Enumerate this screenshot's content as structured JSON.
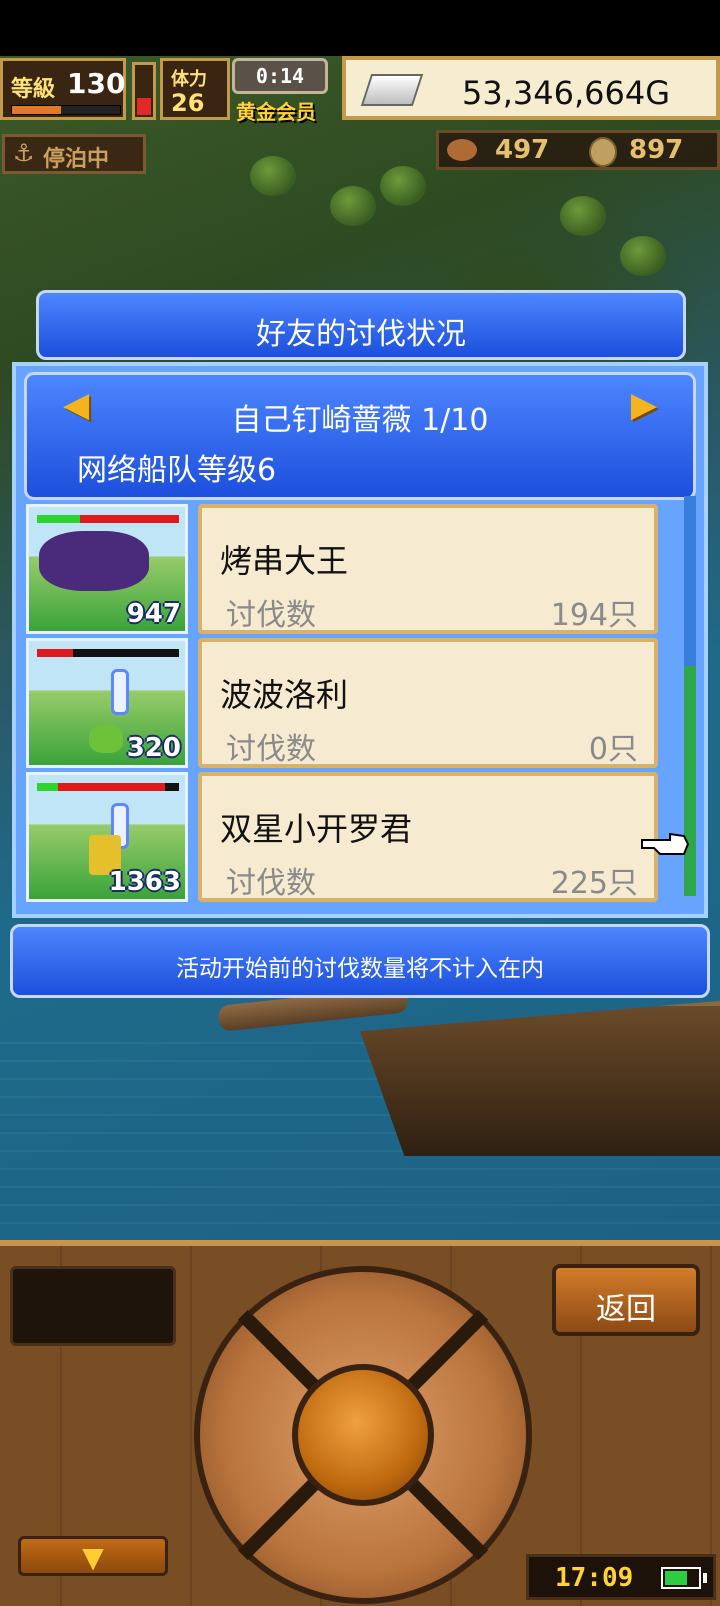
{
  "hud": {
    "level_label": "等級",
    "level": "130",
    "exp_fraction": 0.45,
    "stamina_fraction": 0.35,
    "stamina_label": "体力",
    "stamina": "26",
    "timer": "0:14",
    "member_label": "黄金会员",
    "gold": "53,346,664G",
    "anchored_label": "停泊中",
    "meat": "497",
    "coins": "897"
  },
  "dialog": {
    "title": "好友的讨伐状况",
    "friend_name": "自己钉崎蔷薇 1/10",
    "fleet_level": "网络船队等级6",
    "prev_icon": "◀",
    "next_icon": "▶",
    "rows": [
      {
        "name": "烤串大王",
        "label": "讨伐数",
        "value": "194只",
        "badge": "947",
        "hp_green": 0.3,
        "hp_red": 0.7
      },
      {
        "name": "波波洛利",
        "label": "讨伐数",
        "value": "0只",
        "badge": "320",
        "hp_green": 0.0,
        "hp_red": 0.25
      },
      {
        "name": "双星小开罗君",
        "label": "讨伐数",
        "value": "225只",
        "badge": "1363",
        "hp_green": 0.15,
        "hp_red": 0.75
      }
    ],
    "notice": "活动开始前的讨伐数量将不计入在内"
  },
  "controls": {
    "back_label": "返回",
    "menu_arrow": "▼",
    "clock": "17:09",
    "battery_fraction": 0.7
  }
}
